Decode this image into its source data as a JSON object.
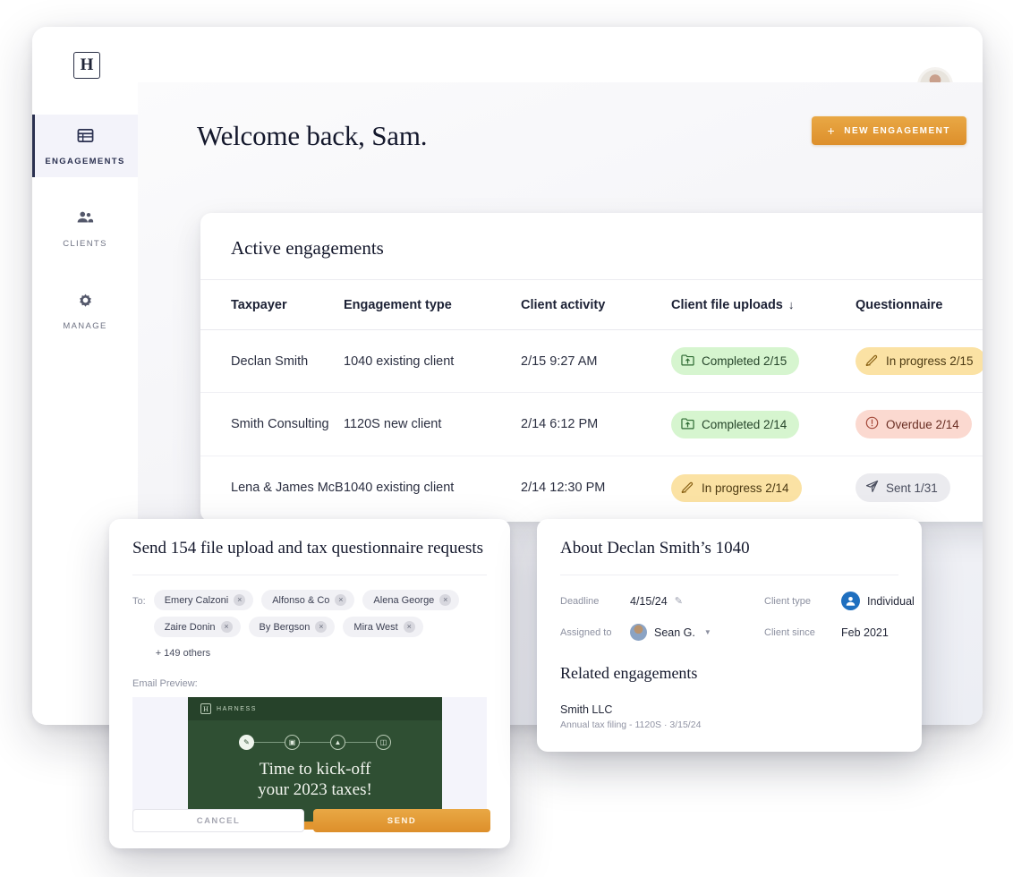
{
  "brand": {
    "logo_letter": "H",
    "name": "HARNESS"
  },
  "sidebar": {
    "items": [
      {
        "label": "ENGAGEMENTS",
        "icon": "table-icon",
        "active": true
      },
      {
        "label": "CLIENTS",
        "icon": "people-icon",
        "active": false
      },
      {
        "label": "MANAGE",
        "icon": "gear-icon",
        "active": false
      }
    ]
  },
  "header": {
    "greeting": "Welcome back, Sam.",
    "new_engagement_label": "NEW ENGAGEMENT",
    "new_engagement_plus": "+",
    "accent_color": "#e2952f"
  },
  "engagements": {
    "title": "Active engagements",
    "columns": [
      {
        "label": "Taxpayer",
        "sorted": false
      },
      {
        "label": "Engagement type",
        "sorted": false
      },
      {
        "label": "Client activity",
        "sorted": false
      },
      {
        "label": "Client file uploads",
        "sorted": true,
        "sort_arrow": "↓"
      },
      {
        "label": "Questionnaire",
        "sorted": false
      }
    ],
    "rows": [
      {
        "taxpayer": "Declan Smith",
        "type": "1040 existing client",
        "activity": "2/15 9:27 AM",
        "uploads": {
          "label": "Completed 2/15",
          "status": "completed",
          "icon": "folder-upload-icon",
          "color": "#d6f5cf"
        },
        "questionnaire": {
          "label": "In progress 2/15",
          "status": "in-progress",
          "icon": "pen-icon",
          "color": "#fbe2a4"
        }
      },
      {
        "taxpayer": "Smith Consulting",
        "type": "1120S new client",
        "activity": "2/14 6:12 PM",
        "uploads": {
          "label": "Completed 2/14",
          "status": "completed",
          "icon": "folder-upload-icon",
          "color": "#d6f5cf"
        },
        "questionnaire": {
          "label": "Overdue 2/14",
          "status": "overdue",
          "icon": "alert-circle-icon",
          "color": "#fbd9d0"
        }
      },
      {
        "taxpayer": "Lena & James McB",
        "type": "1040 existing client",
        "activity": "2/14 12:30 PM",
        "uploads": {
          "label": "In progress 2/14",
          "status": "in-progress",
          "icon": "pen-icon",
          "color": "#fbe2a4"
        },
        "questionnaire": {
          "label": "Sent 1/31",
          "status": "sent",
          "icon": "paper-plane-icon",
          "color": "#ebebef"
        }
      }
    ]
  },
  "send_modal": {
    "title": "Send 154 file upload and tax questionnaire requests",
    "to_label": "To:",
    "recipients": [
      "Emery Calzoni",
      "Alfonso & Co",
      "Alena George",
      "Zaire Donin",
      "By Bergson",
      "Mira West"
    ],
    "more_label": "+ 149 others",
    "remove_glyph": "×",
    "email_preview_label": "Email Preview:",
    "email": {
      "brand": "HARNESS",
      "logo_letter": "H",
      "headline_line1": "Time to kick-off",
      "headline_line2": "your 2023 taxes!",
      "steps": [
        {
          "icon": "pen-step-icon",
          "state": "done"
        },
        {
          "icon": "calendar-step-icon",
          "state": "todo"
        },
        {
          "icon": "upload-step-icon",
          "state": "todo"
        },
        {
          "icon": "file-step-icon",
          "state": "todo"
        }
      ]
    },
    "cancel_label": "CANCEL",
    "send_label": "SEND"
  },
  "about_panel": {
    "title": "About Declan Smith’s 1040",
    "fields": {
      "deadline_label": "Deadline",
      "deadline_value": "4/15/24",
      "assigned_label": "Assigned to",
      "assigned_value": "Sean G.",
      "client_type_label": "Client type",
      "client_type_value": "Individual",
      "client_since_label": "Client since",
      "client_since_value": "Feb 2021"
    },
    "related_title": "Related engagements",
    "related": [
      {
        "name": "Smith LLC",
        "detail": "Annual tax filing - 1120S · 3/15/24"
      }
    ]
  }
}
